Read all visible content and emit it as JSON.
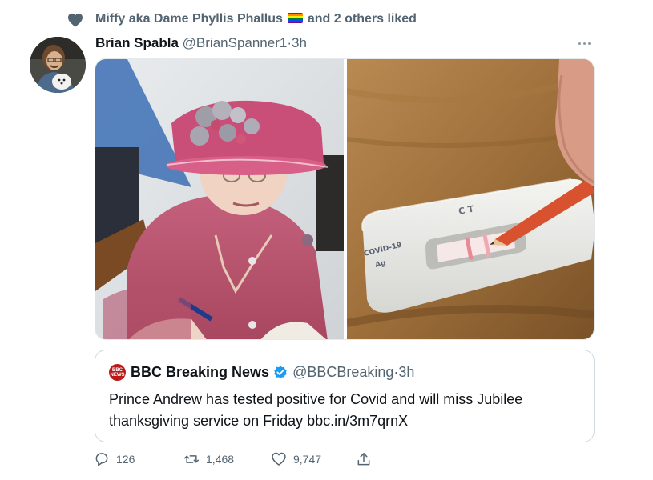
{
  "social_context": {
    "liker_name": "Miffy aka Dame Phyllis Phallus",
    "others_text": "and 2 others liked",
    "flag_colors": [
      "#e40303",
      "#ff8c00",
      "#ffed00",
      "#008026",
      "#004dff",
      "#750787"
    ]
  },
  "tweet": {
    "author_name": "Brian Spabla",
    "author_handle": "@BrianSpanner1",
    "dot": "·",
    "time": "3h",
    "media": {
      "left_image": "queen-signing-book",
      "right_image": "covid-test",
      "test_label_line1": "COVID-19",
      "test_label_line2": "Ag",
      "test_marks": "C T"
    }
  },
  "quote": {
    "logo_line1": "BBC",
    "logo_line2": "NEWS",
    "name": "BBC Breaking News",
    "handle": "@BBCBreaking",
    "dot": "·",
    "time": "3h",
    "text": "Prince Andrew has tested positive for Covid and will miss Jubilee thanksgiving service on Friday bbc.in/3m7qrnX"
  },
  "actions": {
    "replies": "126",
    "retweets": "1,468",
    "likes": "9,747"
  },
  "colors": {
    "secondary_text": "#536471",
    "primary_text": "#0f1419",
    "verified": "#1d9bf0",
    "bbc_red": "#bb1919"
  }
}
